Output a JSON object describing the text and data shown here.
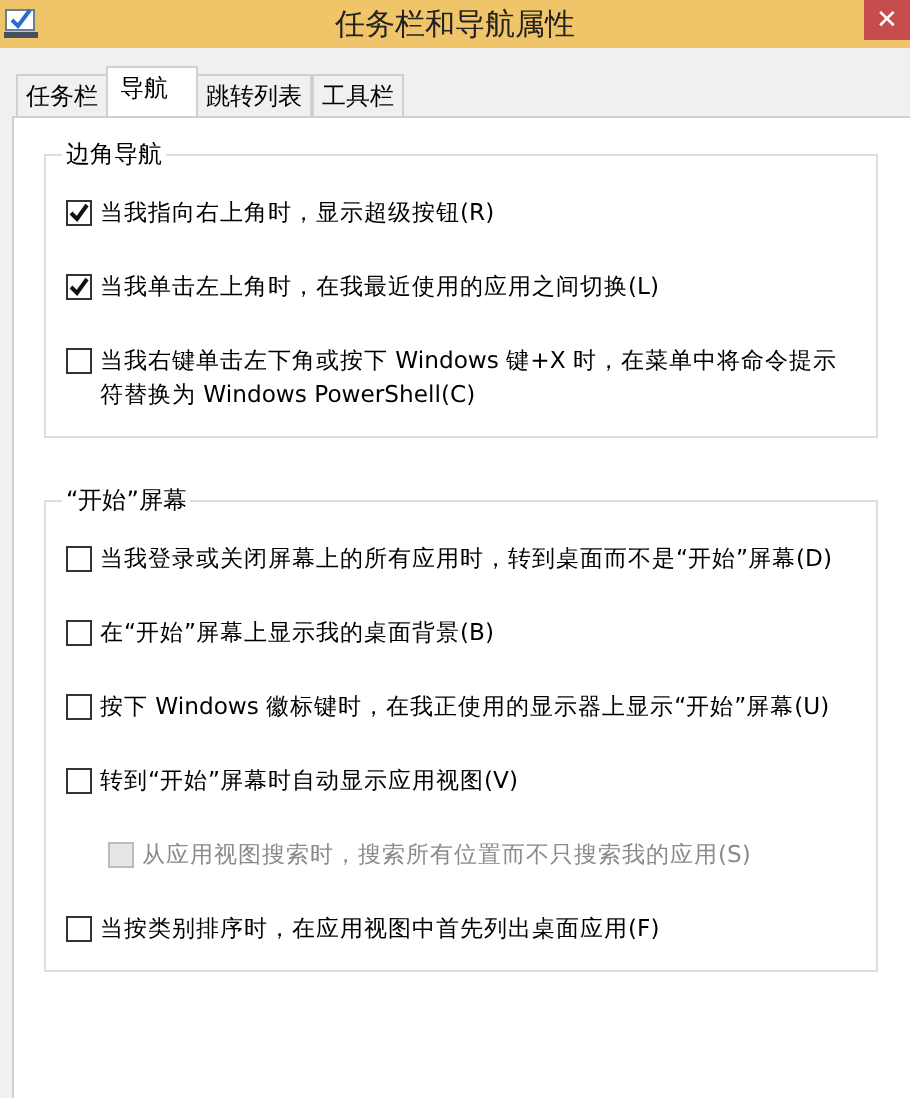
{
  "window": {
    "title": "任务栏和导航属性",
    "close": "✕"
  },
  "tabs": [
    {
      "label": "任务栏",
      "selected": false
    },
    {
      "label": "导航",
      "selected": true
    },
    {
      "label": "跳转列表",
      "selected": false
    },
    {
      "label": "工具栏",
      "selected": false
    }
  ],
  "groups": [
    {
      "title": "边角导航",
      "options": [
        {
          "label": "当我指向右上角时，显示超级按钮(R)",
          "checked": true,
          "disabled": false
        },
        {
          "label": "当我单击左上角时，在我最近使用的应用之间切换(L)",
          "checked": true,
          "disabled": false
        },
        {
          "label": "当我右键单击左下角或按下 Windows 键+X 时，在菜单中将命令提示符替换为 Windows PowerShell(C)",
          "checked": false,
          "disabled": false
        }
      ]
    },
    {
      "title": "“开始”屏幕",
      "options": [
        {
          "label": "当我登录或关闭屏幕上的所有应用时，转到桌面而不是“开始”屏幕(D)",
          "checked": false,
          "disabled": false
        },
        {
          "label": "在“开始”屏幕上显示我的桌面背景(B)",
          "checked": false,
          "disabled": false
        },
        {
          "label": "按下 Windows 徽标键时，在我正使用的显示器上显示“开始”屏幕(U)",
          "checked": false,
          "disabled": false
        },
        {
          "label": "转到“开始”屏幕时自动显示应用视图(V)",
          "checked": false,
          "disabled": false,
          "children": [
            {
              "label": "从应用视图搜索时，搜索所有位置而不只搜索我的应用(S)",
              "checked": false,
              "disabled": true
            }
          ]
        },
        {
          "label": "当按类别排序时，在应用视图中首先列出桌面应用(F)",
          "checked": false,
          "disabled": false
        }
      ]
    }
  ]
}
